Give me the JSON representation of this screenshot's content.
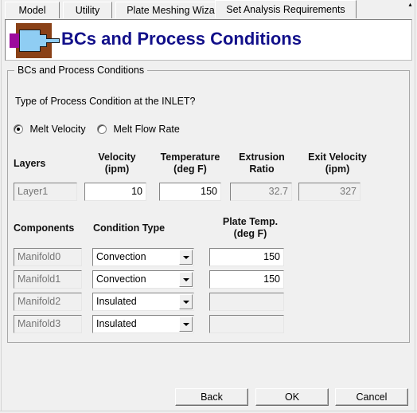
{
  "window": {
    "tabs": [
      {
        "label": "Model",
        "selected": false
      },
      {
        "label": "Utility",
        "selected": false
      },
      {
        "label": "Plate Meshing Wizard",
        "selected": false
      },
      {
        "label": "Set Analysis Requirements",
        "selected": true
      }
    ],
    "scroll_up_glyph": "▴"
  },
  "banner": {
    "title": "BCs and Process Conditions",
    "title_color": "#12108a",
    "icon_name": "extrusion-die-icon",
    "icon_colors": {
      "block": "#8a4117",
      "plug": "#8fcdf3",
      "inlet": "#9c0a9c"
    }
  },
  "group": {
    "legend": "BCs and Process Conditions",
    "prompt": "Type of Process Condition at the INLET?",
    "radios": [
      {
        "label": "Melt Velocity",
        "selected": true
      },
      {
        "label": "Melt Flow Rate",
        "selected": false
      }
    ],
    "layers_table": {
      "headers": [
        {
          "line1": "Layers",
          "line2": ""
        },
        {
          "line1": "Velocity",
          "line2": "(ipm)"
        },
        {
          "line1": "Temperature",
          "line2": "(deg F)"
        },
        {
          "line1": "Extrusion",
          "line2": "Ratio"
        },
        {
          "line1": "Exit Velocity",
          "line2": "(ipm)"
        }
      ],
      "rows": [
        {
          "layer": "Layer1",
          "velocity": "10",
          "temperature": "150",
          "extrusion_ratio": "32.7",
          "exit_velocity": "327"
        }
      ]
    },
    "components_table": {
      "headers": [
        {
          "line1": "Components",
          "line2": ""
        },
        {
          "line1": "Condition Type",
          "line2": ""
        },
        {
          "line1": "Plate Temp.",
          "line2": "(deg F)"
        }
      ],
      "rows": [
        {
          "component": "Manifold0",
          "condition": "Convection",
          "plate_temp": "150",
          "temp_enabled": true
        },
        {
          "component": "Manifold1",
          "condition": "Convection",
          "plate_temp": "150",
          "temp_enabled": true
        },
        {
          "component": "Manifold2",
          "condition": "Insulated",
          "plate_temp": "",
          "temp_enabled": false
        },
        {
          "component": "Manifold3",
          "condition": "Insulated",
          "plate_temp": "",
          "temp_enabled": false
        }
      ]
    }
  },
  "footer": {
    "buttons": [
      {
        "label": "Back"
      },
      {
        "label": "OK"
      },
      {
        "label": "Cancel"
      }
    ]
  }
}
